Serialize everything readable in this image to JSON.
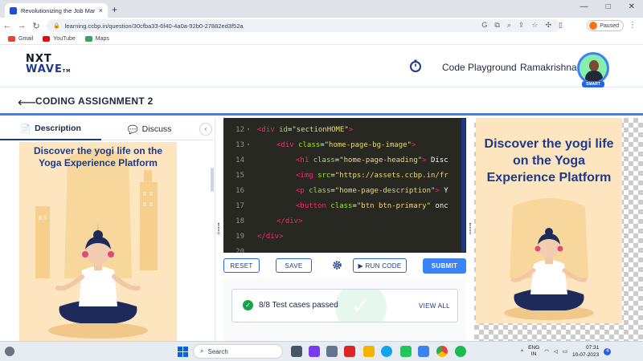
{
  "browser": {
    "tab_title": "Revolutionizing the Job Market | NxtWave",
    "tab_close": "×",
    "new_tab": "+",
    "window_controls": [
      "—",
      "□",
      "✕"
    ],
    "nav_buttons": [
      "←",
      "→",
      "↻"
    ],
    "url": "learning.ccbp.in/question/30cfba33-6f40-4a0a-92b0-27882ed3f52a",
    "profile_status": "Paused",
    "menu": "⋮",
    "bookmarks": [
      {
        "label": "Gmail",
        "color": "#ea4335"
      },
      {
        "label": "YouTube",
        "color": "#ff0000"
      },
      {
        "label": "Maps",
        "color": "#34a853"
      }
    ]
  },
  "header": {
    "logo_line1": "NXT",
    "logo_line2": "WAVE",
    "logo_tm": "TM",
    "playground_label": "Code Playground",
    "user_name": "Ramakrishna",
    "badge_label": "SMART"
  },
  "assignment": {
    "back": "⟵",
    "title": "CODING ASSIGNMENT 2"
  },
  "left_panel": {
    "tabs": [
      {
        "icon": "📄",
        "label": "Description"
      },
      {
        "icon": "💬",
        "label": "Discuss"
      }
    ],
    "collapse": "‹",
    "preview_heading": "Discover the yogi life on the Yoga Experience Platform"
  },
  "editor": {
    "lines": [
      {
        "num": "12",
        "fold": "▾",
        "parts": [
          [
            "tag",
            "<div "
          ],
          [
            "attr",
            "id"
          ],
          [
            "txt",
            "="
          ],
          [
            "str",
            "\"sectionHOME\""
          ],
          [
            "tag",
            ">"
          ]
        ],
        "indent": 0
      },
      {
        "num": "13",
        "fold": "▾",
        "parts": [
          [
            "tag",
            "<div "
          ],
          [
            "attr",
            "class"
          ],
          [
            "txt",
            "="
          ],
          [
            "str",
            "\"home-page-bg-image\""
          ],
          [
            "tag",
            ">"
          ]
        ],
        "indent": 1
      },
      {
        "num": "14",
        "fold": "",
        "parts": [
          [
            "tag",
            "<h1 "
          ],
          [
            "attr",
            "class"
          ],
          [
            "txt",
            "="
          ],
          [
            "str",
            "\"home-page-heading\""
          ],
          [
            "tag",
            ">"
          ],
          [
            "txt",
            " Disc"
          ]
        ],
        "indent": 2
      },
      {
        "num": "15",
        "fold": "",
        "parts": [
          [
            "tag",
            "<img "
          ],
          [
            "attr",
            "src"
          ],
          [
            "txt",
            "="
          ],
          [
            "str",
            "\"https://assets.ccbp.in/fr"
          ]
        ],
        "indent": 2
      },
      {
        "num": "16",
        "fold": "",
        "parts": [
          [
            "tag",
            "<p "
          ],
          [
            "attr",
            "class"
          ],
          [
            "txt",
            "="
          ],
          [
            "str",
            "\"home-page-description\""
          ],
          [
            "tag",
            ">"
          ],
          [
            "txt",
            " Y"
          ]
        ],
        "indent": 2
      },
      {
        "num": "17",
        "fold": "",
        "parts": [
          [
            "tag",
            "<button "
          ],
          [
            "attr",
            "class"
          ],
          [
            "txt",
            "="
          ],
          [
            "str",
            "\"btn btn-primary\""
          ],
          [
            "txt",
            " onc"
          ]
        ],
        "indent": 2
      },
      {
        "num": "18",
        "fold": "",
        "parts": [
          [
            "tag",
            "</div>"
          ]
        ],
        "indent": 1
      },
      {
        "num": "19",
        "fold": "",
        "parts": [
          [
            "tag",
            "</div>"
          ]
        ],
        "indent": 0
      },
      {
        "num": "20",
        "fold": "",
        "parts": [],
        "indent": 0
      }
    ]
  },
  "toolbar": {
    "reset": "RESET",
    "save": "SAVE",
    "run": "▶ RUN CODE",
    "submit": "SUBMIT"
  },
  "results": {
    "check": "✓",
    "text": "8/8 Test cases passed",
    "view_all": "VIEW ALL",
    "passed": 8,
    "total": 8
  },
  "right_panel": {
    "preview_heading": "Discover the yogi life on the Yoga Experience Platform"
  },
  "taskbar": {
    "search_placeholder": "Search",
    "lang_line1": "ENG",
    "lang_line2": "IN",
    "time": "07:31",
    "date": "10-07-2023",
    "notifications": "4",
    "tray_up": "^"
  },
  "colors": {
    "accent": "#3b82f6",
    "brand": "#1e3a8a",
    "success": "#16a34a",
    "editor_bg": "#272822",
    "preview_bg": "#fde6bf"
  }
}
